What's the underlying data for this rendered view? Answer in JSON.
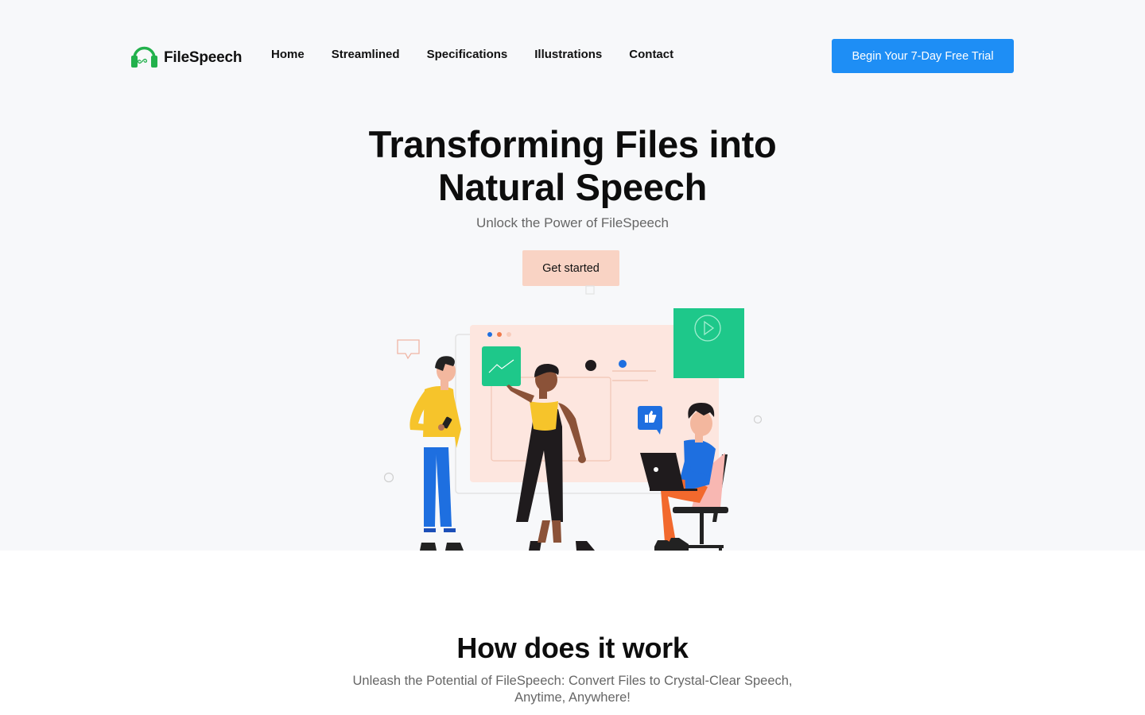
{
  "brand": {
    "name": "FileSpeech",
    "logo_color": "#22b14c",
    "accent": "#1e8ef5",
    "cta_color": "#f9d3c4"
  },
  "nav": {
    "links": [
      "Home",
      "Streamlined",
      "Specifications",
      "Illustrations",
      "Contact"
    ],
    "trial_label": "Begin Your 7-Day Free Trial"
  },
  "hero": {
    "title_line1": "Transforming Files into",
    "title_line2": "Natural Speech",
    "subtitle": "Unlock the Power of FileSpeech",
    "cta_label": "Get started"
  },
  "how": {
    "title": "How does it work",
    "subtitle_line1": "Unleash the Potential of FileSpeech: Convert Files to Crystal-Clear Speech,",
    "subtitle_line2": "Anytime, Anywhere!"
  },
  "icons": {
    "logo": "headphones-infinity-icon",
    "chart": "trend-chart-icon",
    "video": "play-icon",
    "like": "thumbs-up-icon",
    "comment": "speech-bubble-icon"
  }
}
